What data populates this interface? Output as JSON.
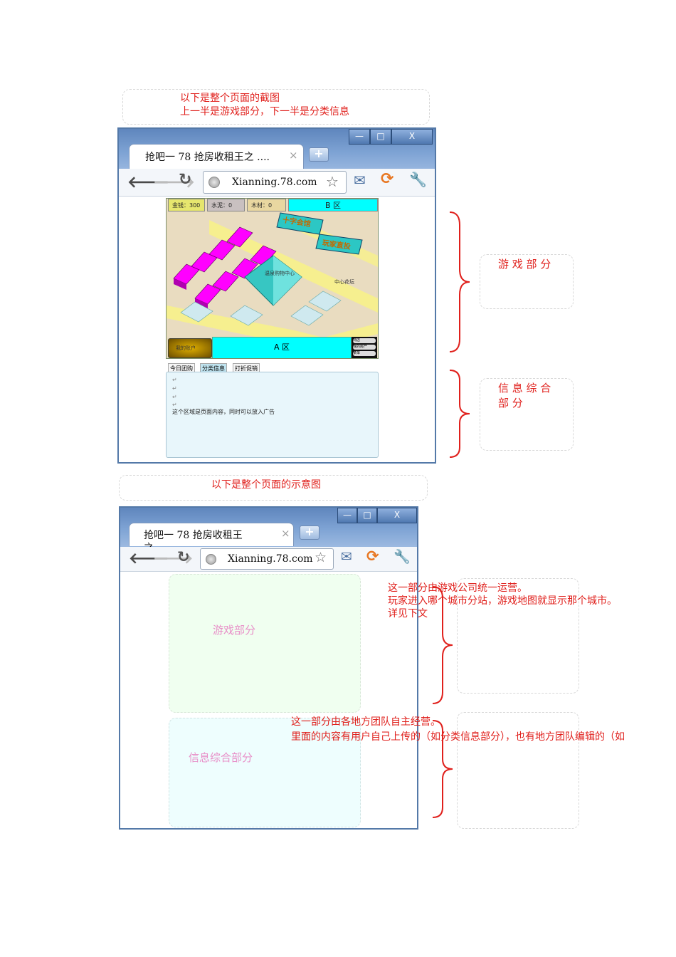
{
  "top_caption": {
    "line1": "以下是整个页面的截图",
    "line2": "上一半是游戏部分，下一半是分类信息"
  },
  "browser1": {
    "tab_title": "抢吧一 78 抢房收租王之 ....",
    "tab_close": "×",
    "new_tab": "+",
    "url": "Xianning.78.com",
    "win_buttons": [
      "—",
      "□",
      "X"
    ]
  },
  "game": {
    "resources": [
      "金钱：300",
      "水泥：0",
      "木材：0"
    ],
    "zone_b": "B 区",
    "zone_a": "A 区",
    "banner1": "十字会馆",
    "banner2": "玩家直投",
    "mall": "温泉购物中心",
    "garden": "中心花坛",
    "gold_button": "我的账户",
    "menu": [
      "商店",
      "我的房产",
      "菜单"
    ]
  },
  "info_section": {
    "tabs": [
      "今日团购",
      "分类信息",
      "打折促销"
    ],
    "content": "这个区域是页面内容，同时可以放入广告"
  },
  "side_labels": {
    "game_part": "游 戏 部 分",
    "info_part_line1": "信 息 综 合",
    "info_part_line2": "部 分"
  },
  "mid_caption": "以下是整个页面的示意图",
  "browser2": {
    "tab_title_line1": "抢吧一 78 抢房收租王",
    "tab_title_line2": "之 ....",
    "tab_close": "×",
    "new_tab": "+",
    "url": "Xianning.78.com",
    "win_buttons": [
      "—",
      "□",
      "X"
    ]
  },
  "schematic": {
    "game_label": "游戏部分",
    "info_label": "信息综合部分"
  },
  "notes": {
    "game_note": [
      "这一部分由游戏公司统一运营。",
      "玩家进入哪个城市分站，游戏地图就显示那个城市。",
      "详见下文"
    ],
    "info_note": [
      "这一部分由各地方团队自主经营。",
      "里面的内容有用户自己上传的（如分类信息部分），也有地方团队编辑的（如"
    ]
  },
  "colors": {
    "annotation_red": "#e0201c",
    "schematic_label_pink": "#e88fc8",
    "game_fill": "#f0fff0",
    "info_fill": "#eefefe",
    "chrome_blue": "#5479a8"
  }
}
